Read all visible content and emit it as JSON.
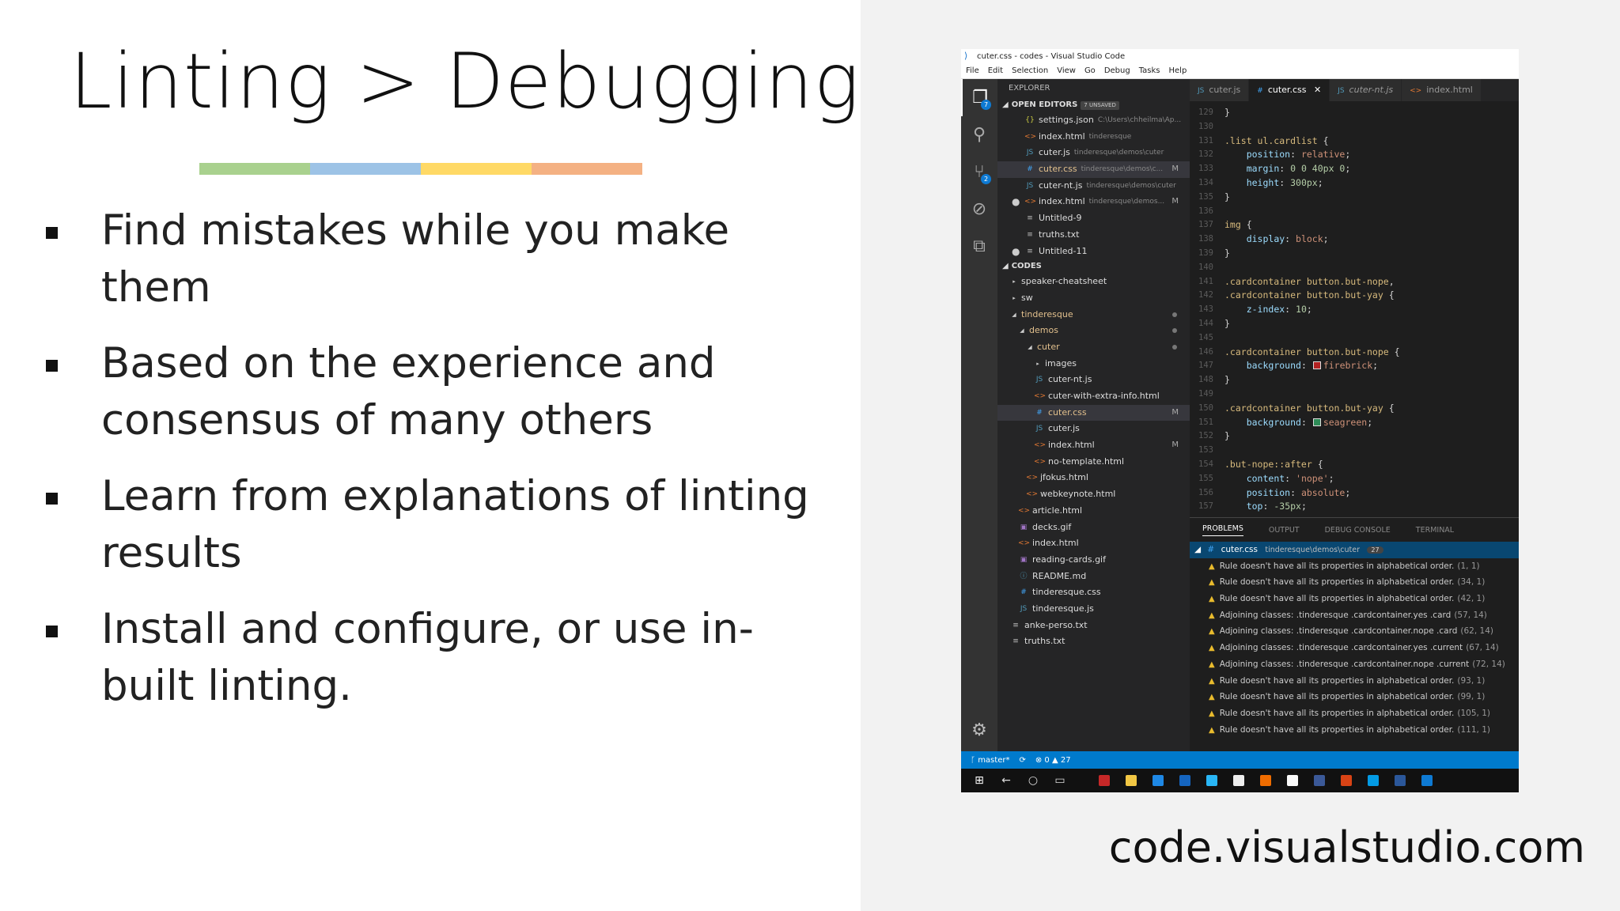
{
  "slide": {
    "title": "Linting > Debugging",
    "bullets": [
      "Find mistakes while you make them",
      "Based on the experience and consensus of many others",
      "Learn from explanations of linting results",
      "Install and configure, or use in-built linting."
    ],
    "url": "code.visualstudio.com",
    "color_bar": [
      "#a9d18e",
      "#9dc3e6",
      "#ffd966",
      "#f4b183"
    ]
  },
  "vscode": {
    "window_title": "cuter.css - codes - Visual Studio Code",
    "menu": [
      "File",
      "Edit",
      "Selection",
      "View",
      "Go",
      "Debug",
      "Tasks",
      "Help"
    ],
    "activity_badges": {
      "explorer": "7",
      "scm": "2"
    },
    "explorer": {
      "header": "EXPLORER",
      "open_editors_label": "OPEN EDITORS",
      "unsaved_count": "7 UNSAVED",
      "open_editors": [
        {
          "icon": "{}",
          "name": "settings.json",
          "desc": "C:\\Users\\chheilma\\Ap...",
          "status": "",
          "modified": false,
          "selected": false,
          "color": "#cbcb41"
        },
        {
          "icon": "<>",
          "name": "index.html",
          "desc": "tinderesque",
          "status": "",
          "modified": false,
          "selected": false,
          "color": "#e37933"
        },
        {
          "icon": "JS",
          "name": "cuter.js",
          "desc": "tinderesque\\demos\\cuter",
          "status": "",
          "modified": false,
          "selected": false,
          "color": "#519aba"
        },
        {
          "icon": "#",
          "name": "cuter.css",
          "desc": "tinderesque\\demos\\c...",
          "status": "M",
          "modified": false,
          "selected": true,
          "color": "#42a5f5"
        },
        {
          "icon": "JS",
          "name": "cuter-nt.js",
          "desc": "tinderesque\\demos\\cuter",
          "status": "",
          "modified": false,
          "selected": false,
          "color": "#519aba"
        },
        {
          "icon": "<>",
          "name": "index.html",
          "desc": "tinderesque\\demos...",
          "status": "M",
          "modified": true,
          "selected": false,
          "color": "#e37933"
        },
        {
          "icon": "≡",
          "name": "Untitled-9",
          "desc": "",
          "status": "",
          "modified": false,
          "selected": false,
          "color": "#bbb"
        },
        {
          "icon": "≡",
          "name": "truths.txt",
          "desc": "",
          "status": "",
          "modified": false,
          "selected": false,
          "color": "#bbb"
        },
        {
          "icon": "≡",
          "name": "Untitled-11",
          "desc": "",
          "status": "",
          "modified": true,
          "selected": false,
          "color": "#bbb"
        }
      ],
      "folder_label": "CODES",
      "tree": [
        {
          "indent": 1,
          "arrow": "▸",
          "icon": "",
          "name": "speaker-cheatsheet",
          "status": "",
          "dot": false,
          "selected": false,
          "color": "#ddd"
        },
        {
          "indent": 1,
          "arrow": "▸",
          "icon": "",
          "name": "sw",
          "status": "",
          "dot": false,
          "selected": false,
          "color": "#ddd"
        },
        {
          "indent": 1,
          "arrow": "◢",
          "icon": "",
          "name": "tinderesque",
          "status": "",
          "dot": true,
          "selected": false,
          "color": "#e2c08d"
        },
        {
          "indent": 2,
          "arrow": "◢",
          "icon": "",
          "name": "demos",
          "status": "",
          "dot": true,
          "selected": false,
          "color": "#e2c08d"
        },
        {
          "indent": 3,
          "arrow": "◢",
          "icon": "",
          "name": "cuter",
          "status": "",
          "dot": true,
          "selected": false,
          "color": "#e2c08d"
        },
        {
          "indent": 4,
          "arrow": "▸",
          "icon": "",
          "name": "images",
          "status": "",
          "dot": false,
          "selected": false,
          "color": "#ddd"
        },
        {
          "indent": 4,
          "arrow": "",
          "icon": "JS",
          "name": "cuter-nt.js",
          "status": "",
          "dot": false,
          "selected": false,
          "color": "#519aba"
        },
        {
          "indent": 4,
          "arrow": "",
          "icon": "<>",
          "name": "cuter-with-extra-info.html",
          "status": "",
          "dot": false,
          "selected": false,
          "color": "#e37933"
        },
        {
          "indent": 4,
          "arrow": "",
          "icon": "#",
          "name": "cuter.css",
          "status": "M",
          "dot": false,
          "selected": true,
          "color": "#42a5f5"
        },
        {
          "indent": 4,
          "arrow": "",
          "icon": "JS",
          "name": "cuter.js",
          "status": "",
          "dot": false,
          "selected": false,
          "color": "#519aba"
        },
        {
          "indent": 4,
          "arrow": "",
          "icon": "<>",
          "name": "index.html",
          "status": "M",
          "dot": false,
          "selected": false,
          "color": "#e37933"
        },
        {
          "indent": 4,
          "arrow": "",
          "icon": "<>",
          "name": "no-template.html",
          "status": "",
          "dot": false,
          "selected": false,
          "color": "#e37933"
        },
        {
          "indent": 3,
          "arrow": "",
          "icon": "<>",
          "name": "jfokus.html",
          "status": "",
          "dot": false,
          "selected": false,
          "color": "#e37933"
        },
        {
          "indent": 3,
          "arrow": "",
          "icon": "<>",
          "name": "webkeynote.html",
          "status": "",
          "dot": false,
          "selected": false,
          "color": "#e37933"
        },
        {
          "indent": 2,
          "arrow": "",
          "icon": "<>",
          "name": "article.html",
          "status": "",
          "dot": false,
          "selected": false,
          "color": "#e37933"
        },
        {
          "indent": 2,
          "arrow": "",
          "icon": "▣",
          "name": "decks.gif",
          "status": "",
          "dot": false,
          "selected": false,
          "color": "#a074c4"
        },
        {
          "indent": 2,
          "arrow": "",
          "icon": "<>",
          "name": "index.html",
          "status": "",
          "dot": false,
          "selected": false,
          "color": "#e37933"
        },
        {
          "indent": 2,
          "arrow": "",
          "icon": "▣",
          "name": "reading-cards.gif",
          "status": "",
          "dot": false,
          "selected": false,
          "color": "#a074c4"
        },
        {
          "indent": 2,
          "arrow": "",
          "icon": "ⓘ",
          "name": "README.md",
          "status": "",
          "dot": false,
          "selected": false,
          "color": "#519aba"
        },
        {
          "indent": 2,
          "arrow": "",
          "icon": "#",
          "name": "tinderesque.css",
          "status": "",
          "dot": false,
          "selected": false,
          "color": "#42a5f5"
        },
        {
          "indent": 2,
          "arrow": "",
          "icon": "JS",
          "name": "tinderesque.js",
          "status": "",
          "dot": false,
          "selected": false,
          "color": "#519aba"
        },
        {
          "indent": 1,
          "arrow": "",
          "icon": "≡",
          "name": "anke-perso.txt",
          "status": "",
          "dot": false,
          "selected": false,
          "color": "#bbb"
        },
        {
          "indent": 1,
          "arrow": "",
          "icon": "≡",
          "name": "truths.txt",
          "status": "",
          "dot": false,
          "selected": false,
          "color": "#bbb"
        }
      ]
    },
    "tabs": [
      {
        "icon": "JS",
        "label": "cuter.js",
        "active": false,
        "close": "",
        "italic": false,
        "color": "#519aba"
      },
      {
        "icon": "#",
        "label": "cuter.css",
        "active": true,
        "close": "✕",
        "italic": false,
        "color": "#42a5f5"
      },
      {
        "icon": "JS",
        "label": "cuter-nt.js",
        "active": false,
        "close": "",
        "italic": true,
        "color": "#519aba"
      },
      {
        "icon": "<>",
        "label": "index.html",
        "active": false,
        "close": "",
        "italic": false,
        "color": "#e37933"
      }
    ],
    "code_lines": [
      {
        "no": "129",
        "html": "}"
      },
      {
        "no": "130",
        "html": ""
      },
      {
        "no": "131",
        "html": "<span class='sel-c'>.list ul.cardlist</span> {"
      },
      {
        "no": "132",
        "html": "    <span class='prop'>position</span>: <span class='val'>relative</span>;"
      },
      {
        "no": "133",
        "html": "    <span class='prop'>margin</span>: <span class='num'>0 0 40px 0</span>;"
      },
      {
        "no": "134",
        "html": "    <span class='prop'>height</span>: <span class='num'>300px</span>;"
      },
      {
        "no": "135",
        "html": "}"
      },
      {
        "no": "136",
        "html": ""
      },
      {
        "no": "137",
        "html": "<span class='sel-c'>img</span> {"
      },
      {
        "no": "138",
        "html": "    <span class='prop'>display</span>: <span class='val'>block</span>;"
      },
      {
        "no": "139",
        "html": "}"
      },
      {
        "no": "140",
        "html": ""
      },
      {
        "no": "141",
        "html": "<span class='sel-c'>.cardcontainer button.but-nope</span>,"
      },
      {
        "no": "142",
        "html": "<span class='sel-c'>.cardcontainer button.but-yay</span> {"
      },
      {
        "no": "143",
        "html": "    <span class='prop'>z-index</span>: <span class='num'>10</span>;"
      },
      {
        "no": "144",
        "html": "}"
      },
      {
        "no": "145",
        "html": ""
      },
      {
        "no": "146",
        "html": "<span class='sel-c'>.cardcontainer button.but-nope</span> {"
      },
      {
        "no": "147",
        "html": "    <span class='prop'>background</span>: <span class='sw' style='background:#b22222'></span><span class='val'>firebrick</span>;"
      },
      {
        "no": "148",
        "html": "}"
      },
      {
        "no": "149",
        "html": ""
      },
      {
        "no": "150",
        "html": "<span class='sel-c'>.cardcontainer button.but-yay</span> {"
      },
      {
        "no": "151",
        "html": "    <span class='prop'>background</span>: <span class='sw' style='background:#2e8b57'></span><span class='val'>seagreen</span>;"
      },
      {
        "no": "152",
        "html": "}"
      },
      {
        "no": "153",
        "html": ""
      },
      {
        "no": "154",
        "html": "<span class='sel-c'>.but-nope::after</span> {"
      },
      {
        "no": "155",
        "html": "    <span class='prop'>content</span>: <span class='val'>'nope'</span>;"
      },
      {
        "no": "156",
        "html": "    <span class='prop'>position</span>: <span class='val'>absolute</span>;"
      },
      {
        "no": "157",
        "html": "    <span class='prop'>top</span>: <span class='num'>-35px</span>;"
      }
    ],
    "panel_tabs": [
      "PROBLEMS",
      "OUTPUT",
      "DEBUG CONSOLE",
      "TERMINAL"
    ],
    "problems_file": {
      "name": "cuter.css",
      "path": "tinderesque\\demos\\cuter",
      "count": "27"
    },
    "problems": [
      {
        "msg": "Rule doesn't have all its properties in alphabetical order.",
        "pos": "(1, 1)"
      },
      {
        "msg": "Rule doesn't have all its properties in alphabetical order.",
        "pos": "(34, 1)"
      },
      {
        "msg": "Rule doesn't have all its properties in alphabetical order.",
        "pos": "(42, 1)"
      },
      {
        "msg": "Adjoining classes: .tinderesque .cardcontainer.yes .card",
        "pos": "(57, 14)"
      },
      {
        "msg": "Adjoining classes: .tinderesque .cardcontainer.nope .card",
        "pos": "(62, 14)"
      },
      {
        "msg": "Adjoining classes: .tinderesque .cardcontainer.yes .current",
        "pos": "(67, 14)"
      },
      {
        "msg": "Adjoining classes: .tinderesque .cardcontainer.nope .current",
        "pos": "(72, 14)"
      },
      {
        "msg": "Rule doesn't have all its properties in alphabetical order.",
        "pos": "(93, 1)"
      },
      {
        "msg": "Rule doesn't have all its properties in alphabetical order.",
        "pos": "(99, 1)"
      },
      {
        "msg": "Rule doesn't have all its properties in alphabetical order.",
        "pos": "(105, 1)"
      },
      {
        "msg": "Rule doesn't have all its properties in alphabetical order.",
        "pos": "(111, 1)"
      }
    ],
    "status": {
      "branch": "master*",
      "errors": "0",
      "warnings": "27"
    },
    "taskbar_apps": [
      {
        "name": "flag",
        "color": "#c62828"
      },
      {
        "name": "folder",
        "color": "#f2c744"
      },
      {
        "name": "edge",
        "color": "#1e88e5"
      },
      {
        "name": "outlook",
        "color": "#1565c0"
      },
      {
        "name": "skype",
        "color": "#29b6f6"
      },
      {
        "name": "github",
        "color": "#eeeeee"
      },
      {
        "name": "firefox",
        "color": "#ef6c00"
      },
      {
        "name": "hub",
        "color": "#fafafa"
      },
      {
        "name": "facebook",
        "color": "#3b5998"
      },
      {
        "name": "powerpoint",
        "color": "#d84315"
      },
      {
        "name": "app-blue",
        "color": "#039be5"
      },
      {
        "name": "word",
        "color": "#2b579a"
      },
      {
        "name": "vscode",
        "color": "#0e7ad3"
      }
    ]
  }
}
